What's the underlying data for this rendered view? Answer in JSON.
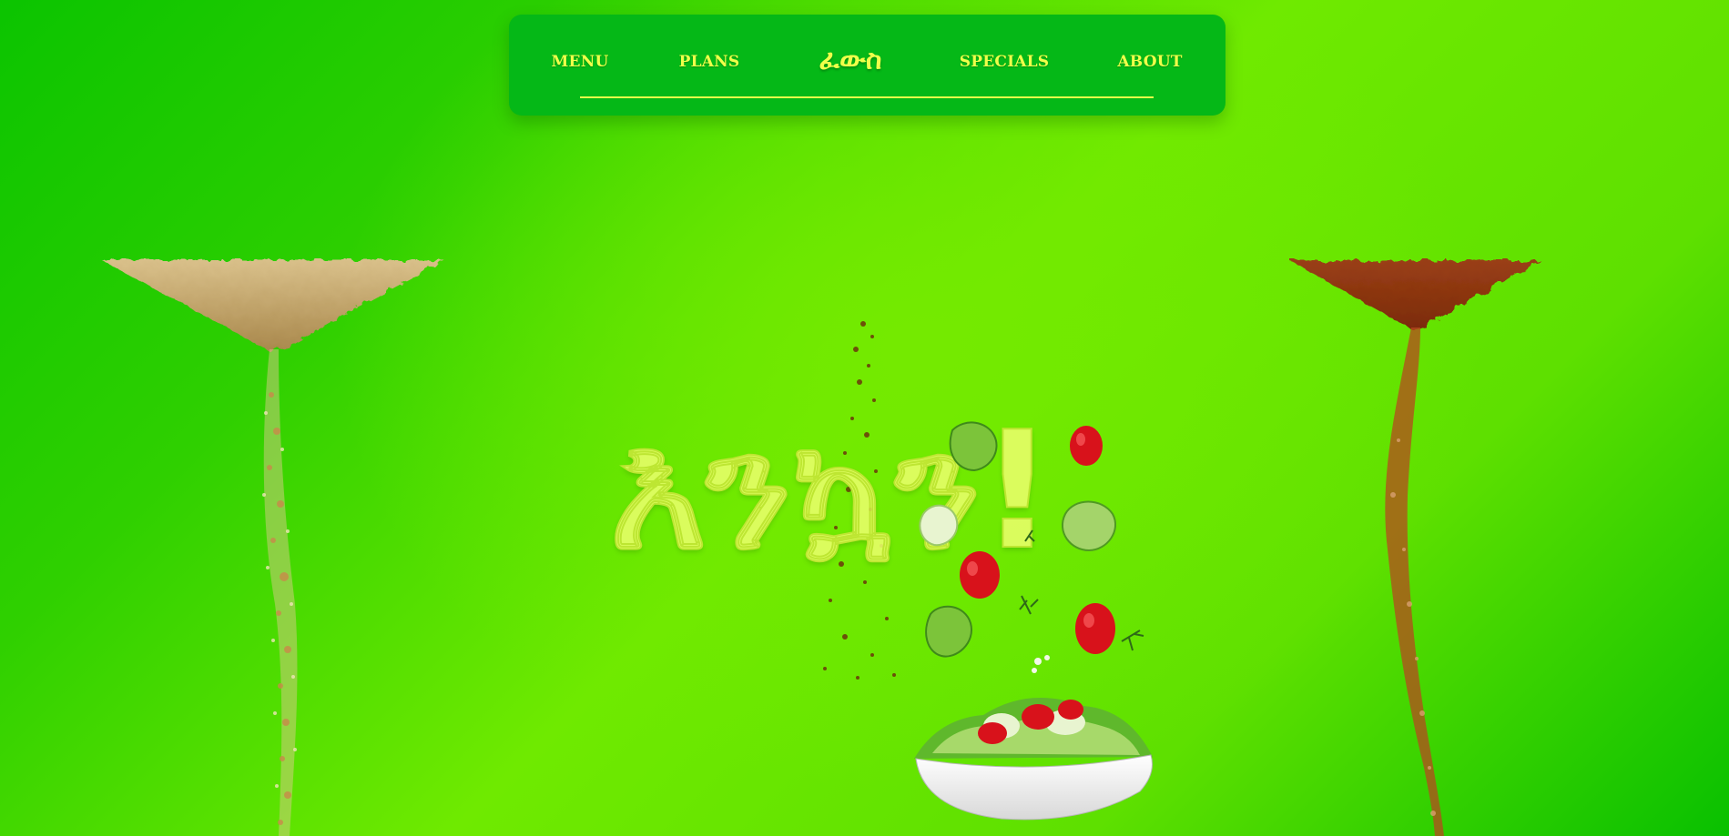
{
  "nav": {
    "items": [
      "MENU",
      "PLANS",
      "SPECIALS",
      "ABOUT"
    ],
    "logo": "ፈውስ"
  },
  "hero": {
    "title": "እንኳን!"
  },
  "colors": {
    "background": "#4fdd00",
    "nav_background": "#05b817",
    "accent_text": "#f0ff4a"
  },
  "icons": [
    "spice-cone-beige",
    "spice-cone-red",
    "salad-bowl",
    "tomato",
    "lettuce-leaf",
    "pepper-dust"
  ]
}
